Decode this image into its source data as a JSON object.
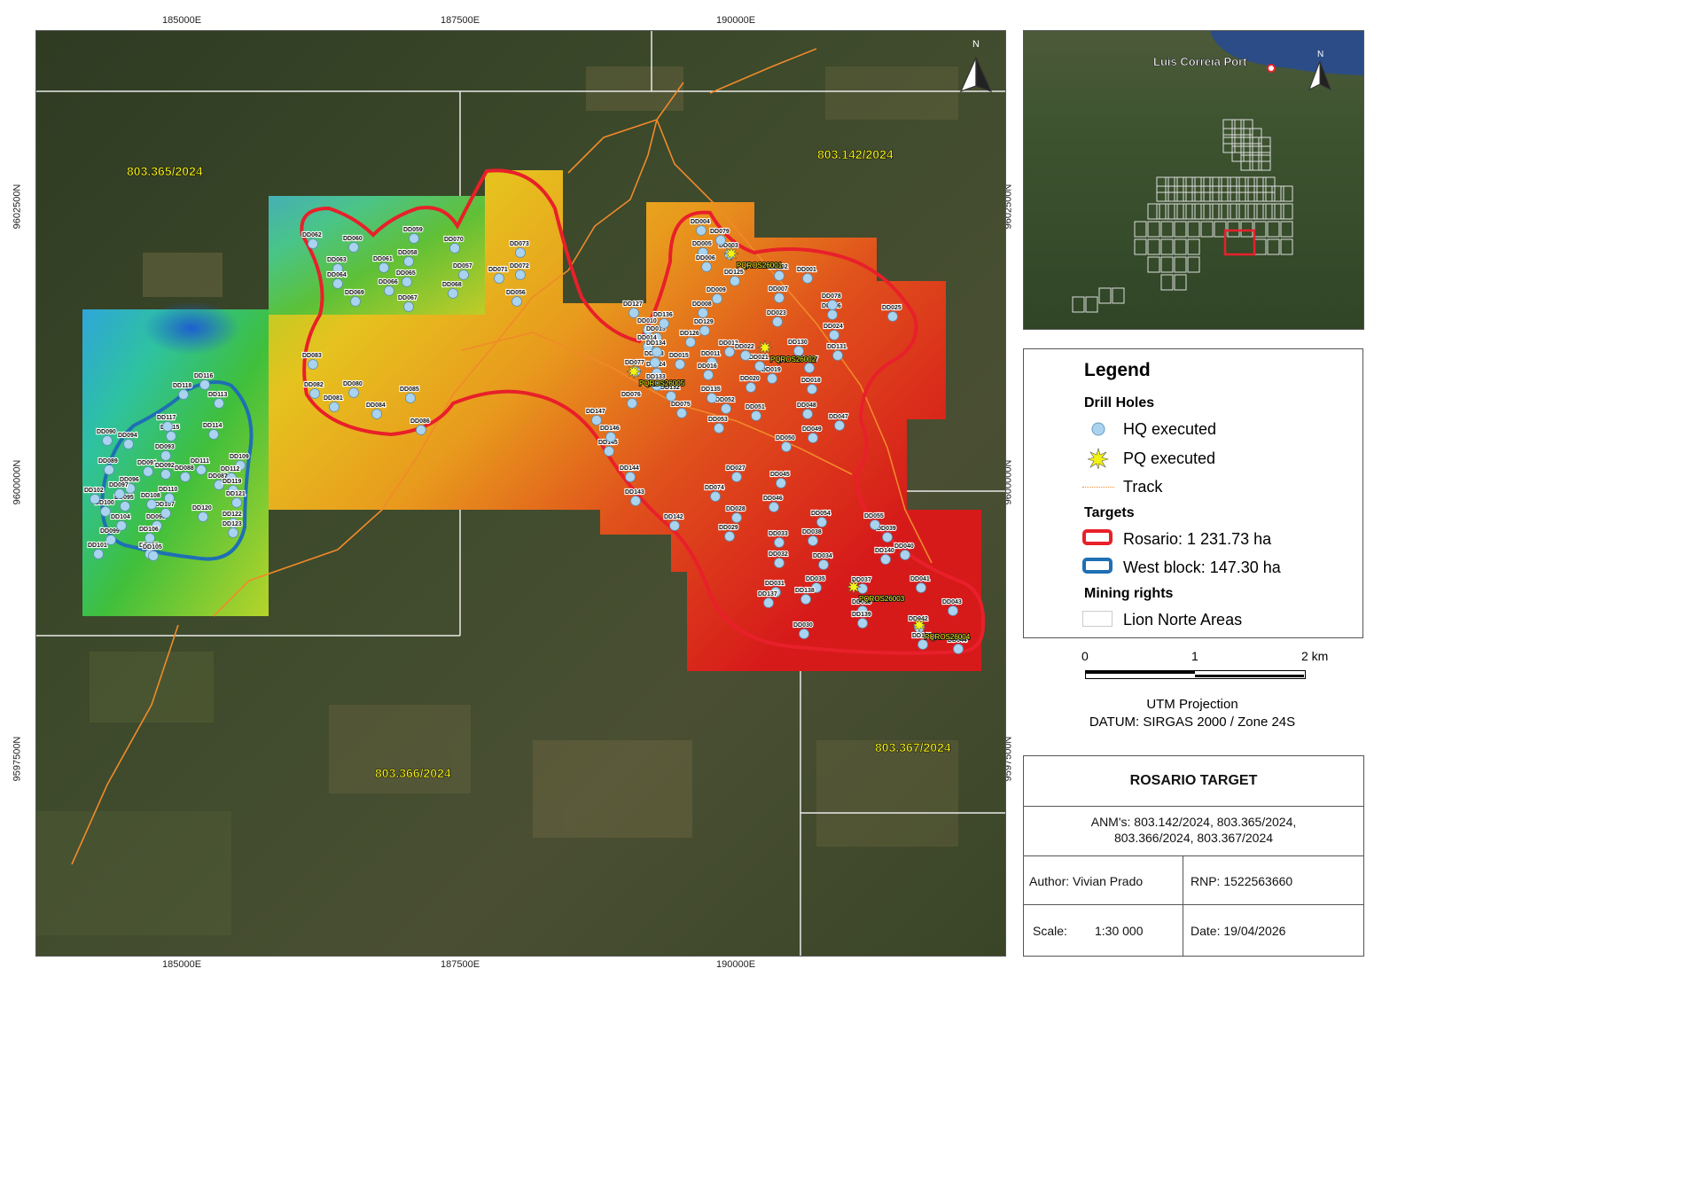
{
  "coords": {
    "x_ticks": [
      "185000E",
      "187500E",
      "190000E"
    ],
    "y_ticks": [
      "9602500N",
      "9600000N",
      "9597500N"
    ]
  },
  "main_map": {
    "north_label": "N",
    "mining_rights": [
      "803.365/2024",
      "803.142/2024",
      "803.366/2024",
      "803.367/2024"
    ],
    "drill_holes_hq": [
      "DD001",
      "DD002",
      "DD003",
      "DD004",
      "DD005",
      "DD006",
      "DD007",
      "DD008",
      "DD009",
      "DD010",
      "DD011",
      "DD012",
      "DD013",
      "DD014",
      "DD015",
      "DD016",
      "DD017",
      "DD018",
      "DD019",
      "DD020",
      "DD021",
      "DD022",
      "DD023",
      "DD024",
      "DD025",
      "DD026",
      "DD027",
      "DD028",
      "DD029",
      "DD030",
      "DD031",
      "DD032",
      "DD033",
      "DD034",
      "DD035",
      "DD036",
      "DD037",
      "DD038",
      "DD039",
      "DD040",
      "DD041",
      "DD042",
      "DD043",
      "DD044",
      "DD045",
      "DD046",
      "DD047",
      "DD048",
      "DD049",
      "DD050",
      "DD051",
      "DD052",
      "DD053",
      "DD054",
      "DD055",
      "DD056",
      "DD057",
      "DD058",
      "DD059",
      "DD060",
      "DD061",
      "DD062",
      "DD063",
      "DD064",
      "DD065",
      "DD066",
      "DD067",
      "DD068",
      "DD069",
      "DD070",
      "DD071",
      "DD072",
      "DD073",
      "DD074",
      "DD075",
      "DD076",
      "DD077",
      "DD078",
      "DD079",
      "DD080",
      "DD081",
      "DD082",
      "DD083",
      "DD084",
      "DD085",
      "DD086",
      "DD087",
      "DD088",
      "DD089",
      "DD090",
      "DD091",
      "DD092",
      "DD093",
      "DD094",
      "DD095",
      "DD096",
      "DD097",
      "DD098",
      "DD099",
      "DD100",
      "DD101",
      "DD102",
      "DD103",
      "DD104",
      "DD105",
      "DD106",
      "DD107",
      "DD108",
      "DD109",
      "DD110",
      "DD111",
      "DD112",
      "DD113",
      "DD114",
      "DD115",
      "DD116",
      "DD117",
      "DD118",
      "DD119",
      "DD120",
      "DD121",
      "DD122",
      "DD123",
      "DD124",
      "DD125",
      "DD126",
      "DD127",
      "DD128",
      "DD129",
      "DD130",
      "DD131",
      "DD132",
      "DD133",
      "DD134",
      "DD135",
      "DD136",
      "DD137",
      "DD138",
      "DD139",
      "DD140",
      "DD141",
      "DD142",
      "DD143",
      "DD144",
      "DD145",
      "DD146",
      "DD147"
    ],
    "drill_holes_pq": [
      "PQROS26001",
      "PQROS26002",
      "PQROS26003",
      "PQROS26004",
      "PQROS26005"
    ]
  },
  "inset": {
    "port_label": "Luis Correia Port",
    "north_label": "N"
  },
  "legend": {
    "title": "Legend",
    "drill_holes_heading": "Drill Holes",
    "hq_label": "HQ executed",
    "pq_label": "PQ executed",
    "track_label": "Track",
    "targets_heading": "Targets",
    "rosario_label": "Rosario: 1 231.73 ha",
    "west_label": "West block: 147.30 ha",
    "mining_heading": "Mining rights",
    "lion_label": "Lion Norte Areas",
    "colors": {
      "hq": "#a9d3ef",
      "pq": "#f2f214",
      "track": "#f08a2a",
      "rosario": "#e8202a",
      "west": "#1f6fb4",
      "lion": "#cccccc"
    }
  },
  "scale_bar": {
    "ticks": [
      "0",
      "1",
      "2 km"
    ],
    "projection": "UTM Projection",
    "datum": "DATUM: SIRGAS 2000 / Zone 24S"
  },
  "title_block": {
    "title": "ROSARIO TARGET",
    "anm_line1": "ANM's: 803.142/2024, 803.365/2024,",
    "anm_line2": "803.366/2024, 803.367/2024",
    "author": "Author: Vivian Prado",
    "rnp": "RNP: 1522563660",
    "scale_label": "Scale:",
    "scale_value": "1:30 000",
    "date": "Date: 19/04/2026"
  }
}
